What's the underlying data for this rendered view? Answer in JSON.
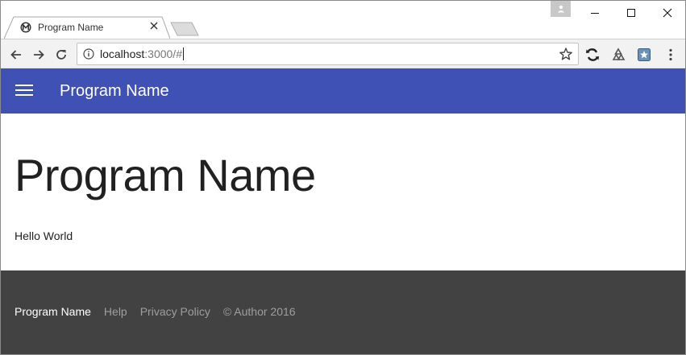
{
  "browser": {
    "tab": {
      "title": "Program Name",
      "favicon": "m-logo-icon"
    },
    "address": {
      "host": "localhost",
      "rest": ":3000/#"
    },
    "colors": {
      "toolbar": "#f2f2f2",
      "tab": "#ffffff",
      "frame_border": "#8a8a8a"
    }
  },
  "app": {
    "title": "Program Name",
    "colors": {
      "primary": "#3f51b5",
      "footer": "#424242",
      "footer_link": "#9e9e9e"
    }
  },
  "main": {
    "heading": "Program Name",
    "body": "Hello World"
  },
  "footer": {
    "brand": "Program Name",
    "links": [
      "Help",
      "Privacy Policy"
    ],
    "copyright": "© Author 2016"
  }
}
